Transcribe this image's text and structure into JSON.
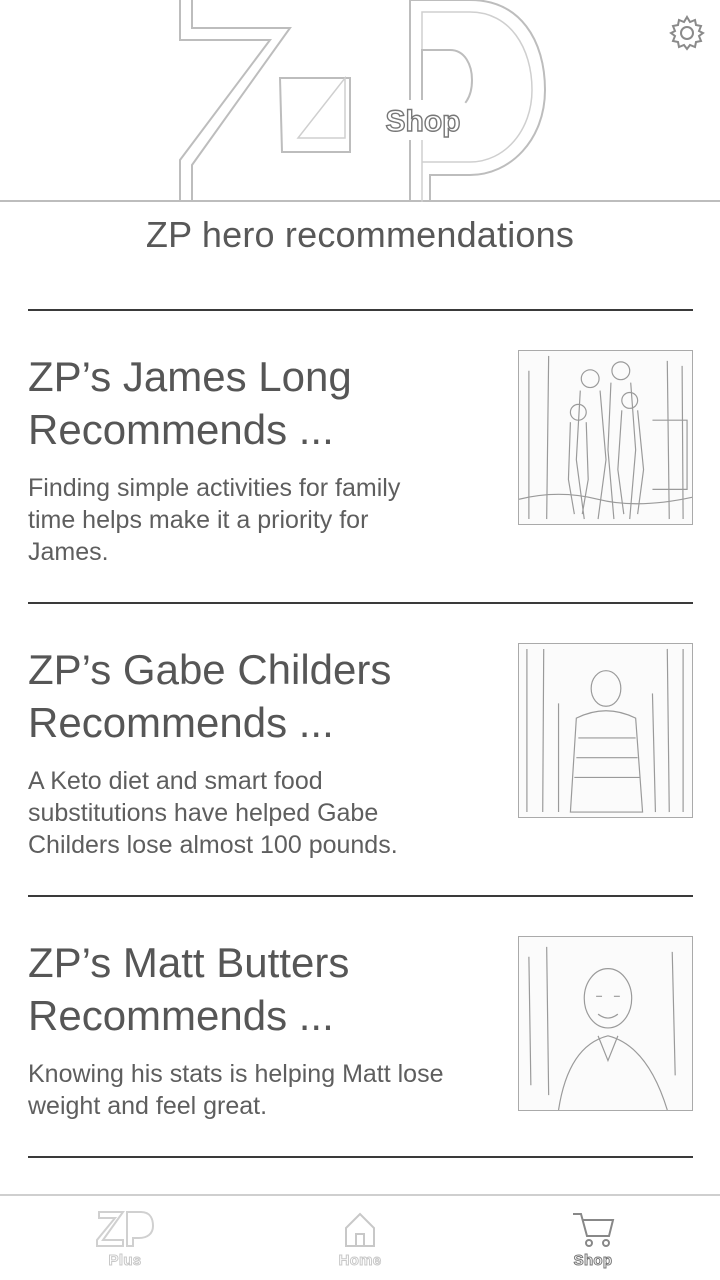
{
  "header": {
    "logo_text": "ZP",
    "logo_badge": "Shop"
  },
  "section_title": "ZP hero recommendations",
  "cards": [
    {
      "title_line1": "ZP’s James Long",
      "title_line2": "Recommends ...",
      "desc_line1": "Finding simple activities for family",
      "desc_line2": "time helps make it a priority for",
      "desc_line3": "James."
    },
    {
      "title_line1": "ZP’s Gabe Childers",
      "title_line2": "Recommends ...",
      "desc_line1": "A Keto diet and smart food",
      "desc_line2": "substitutions have helped Gabe",
      "desc_line3": "Childers lose almost 100 pounds."
    },
    {
      "title_line1": "ZP’s Matt Butters",
      "title_line2": "Recommends ...",
      "desc_line1": "Knowing his stats is helping Matt lose",
      "desc_line2": "weight and feel great.",
      "desc_line3": ""
    }
  ],
  "bottom_nav": {
    "items": [
      {
        "label": "Plus",
        "icon": "zp-logo-icon",
        "active": false
      },
      {
        "label": "Home",
        "icon": "home-icon",
        "active": false
      },
      {
        "label": "Shop",
        "icon": "cart-icon",
        "active": true
      }
    ]
  }
}
